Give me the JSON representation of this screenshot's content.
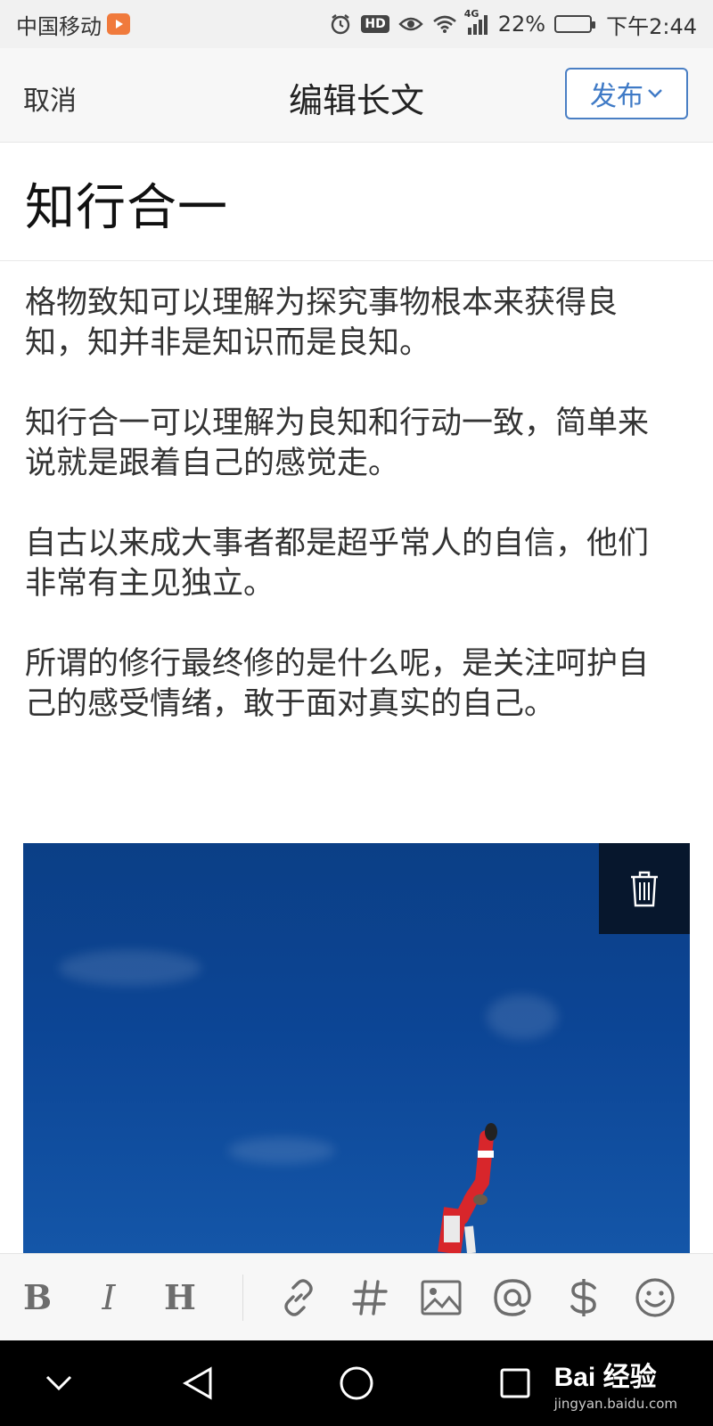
{
  "status_bar": {
    "carrier": "中国移动",
    "hd": "HD",
    "network": "4G",
    "battery_percent": "22%",
    "battery_level": 0.22,
    "time": "下午2:44"
  },
  "header": {
    "cancel_label": "取消",
    "title": "编辑长文",
    "publish_label": "发布"
  },
  "article": {
    "title": "知行合一",
    "paragraphs": [
      "格物致知可以理解为探究事物根本来获得良知，知并非是知识而是良知。",
      "知行合一可以理解为良知和行动一致，简单来说就是跟着自己的感觉走。",
      "自古以来成大事者都是超乎常人的自信，他们非常有主见独立。",
      "所谓的修行最终修的是什么呢，是关注呵护自己的感受情绪，敢于面对真实的自己。"
    ]
  },
  "toolbar": {
    "bold": "B",
    "italic": "I",
    "heading": "H"
  },
  "watermark": {
    "main": "Bai 经验",
    "sub": "jingyan.baidu.com"
  },
  "colors": {
    "accent": "#3f7ac6",
    "sky": "#0c4595"
  }
}
